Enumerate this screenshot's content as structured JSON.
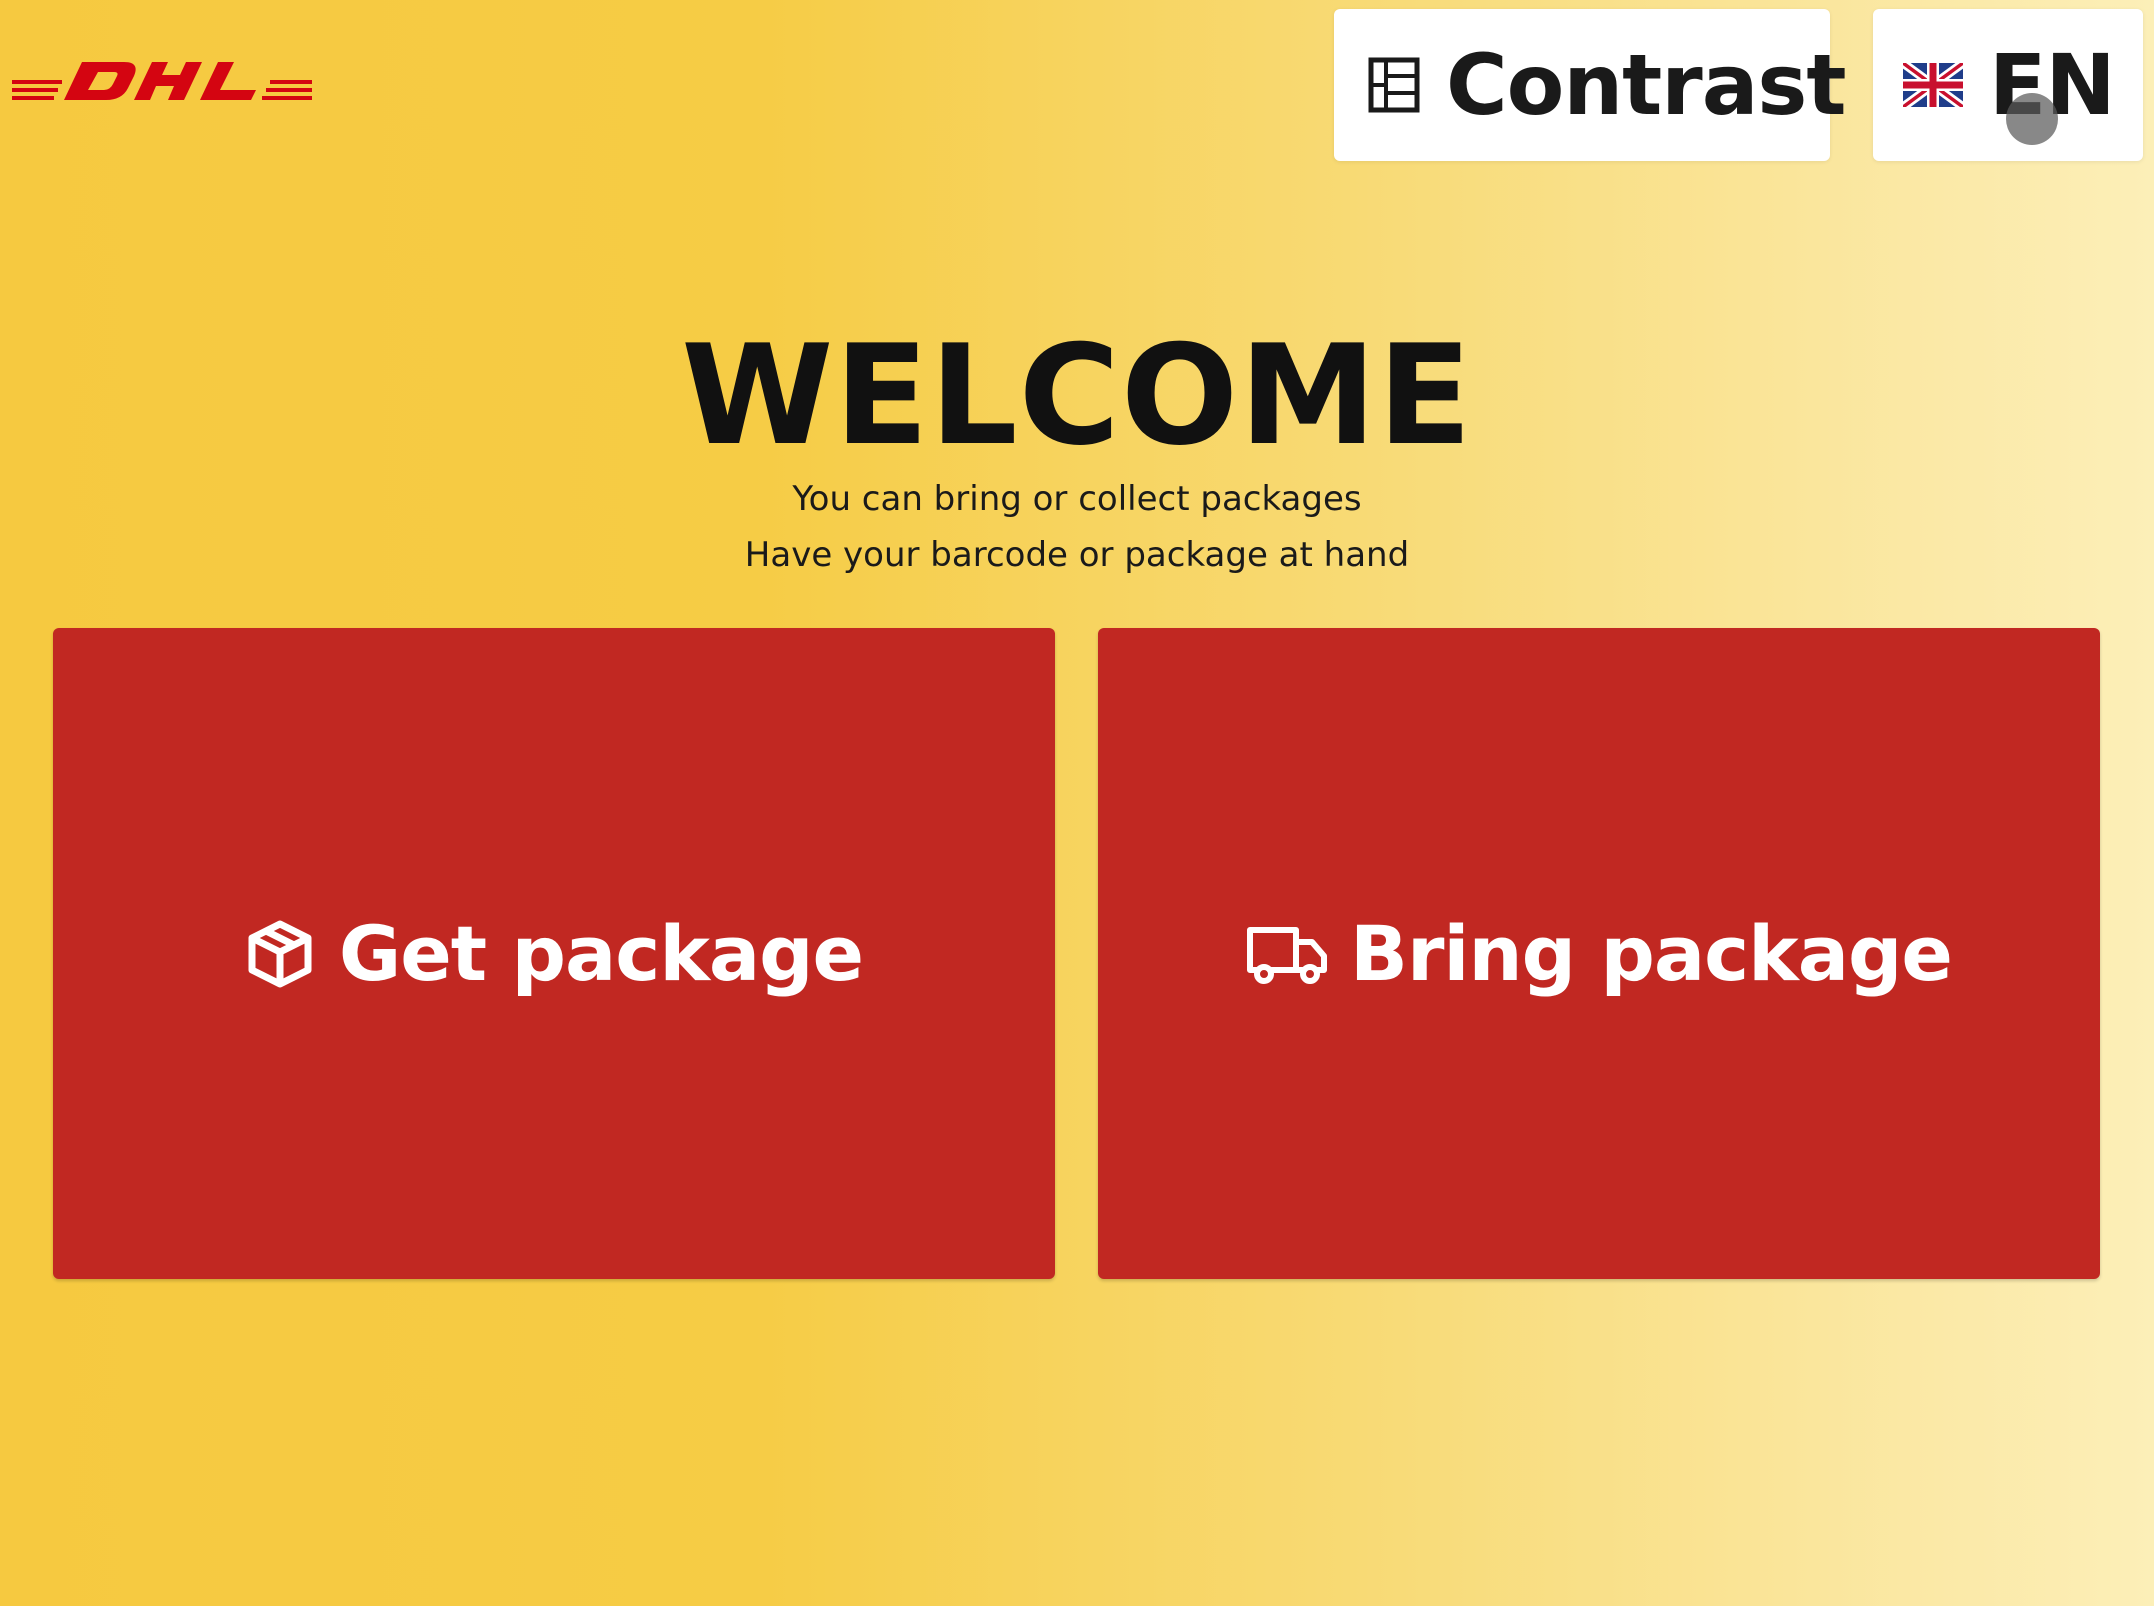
{
  "brand": {
    "logo_text": "DHL",
    "logo_color": "#d40511"
  },
  "header": {
    "contrast_label": "Contrast",
    "contrast_icon": "contrast-grid-icon",
    "language_label": "EN",
    "language_icon": "uk-flag-icon"
  },
  "main": {
    "title": "WELCOME",
    "subtitle_line1": "You can bring or collect packages",
    "subtitle_line2": "Have your barcode or package at hand"
  },
  "actions": {
    "get_package_label": "Get package",
    "get_package_icon": "package-box-icon",
    "bring_package_label": "Bring package",
    "bring_package_icon": "delivery-truck-icon"
  },
  "colors": {
    "button_red": "#c12822",
    "background_yellow": "#f6c940",
    "text_dark": "#111111"
  }
}
